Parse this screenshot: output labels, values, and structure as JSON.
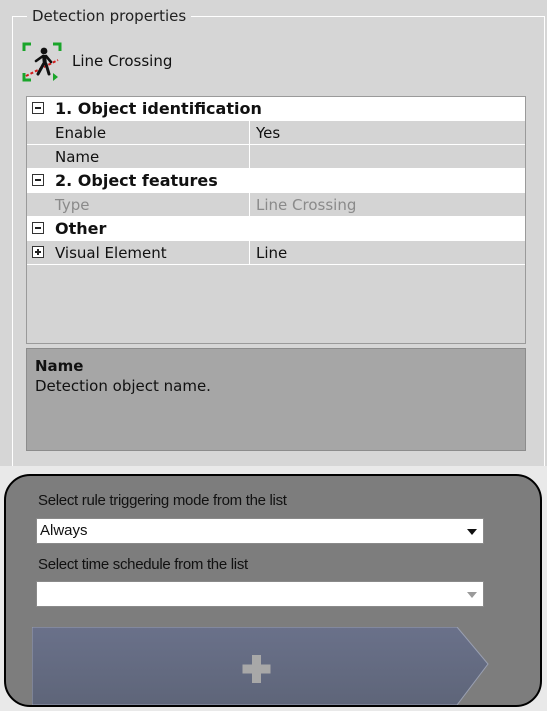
{
  "detection_properties": {
    "group_title": "Detection properties",
    "detector_name": "Line Crossing",
    "detector_icon": "line-crossing-icon",
    "grid": [
      {
        "kind": "category",
        "label": "1. Object identification",
        "expanded": true
      },
      {
        "kind": "property",
        "name": "Enable",
        "value": "Yes",
        "disabled": false
      },
      {
        "kind": "property",
        "name": "Name",
        "value": "",
        "disabled": false
      },
      {
        "kind": "category",
        "label": "2. Object features",
        "expanded": true
      },
      {
        "kind": "property",
        "name": "Type",
        "value": "Line Crossing",
        "disabled": true
      },
      {
        "kind": "category",
        "label": "Other",
        "expanded": true
      },
      {
        "kind": "property",
        "name": "Visual Element",
        "value": "Line",
        "disabled": false,
        "expandable": true
      }
    ],
    "description": {
      "title": "Name",
      "text": "Detection object name."
    }
  },
  "rules": {
    "trigger_mode_label": "Select rule triggering mode from the list",
    "trigger_mode_value": "Always",
    "schedule_label": "Select time schedule from the list",
    "schedule_value": "",
    "add_icon": "plus-icon"
  }
}
